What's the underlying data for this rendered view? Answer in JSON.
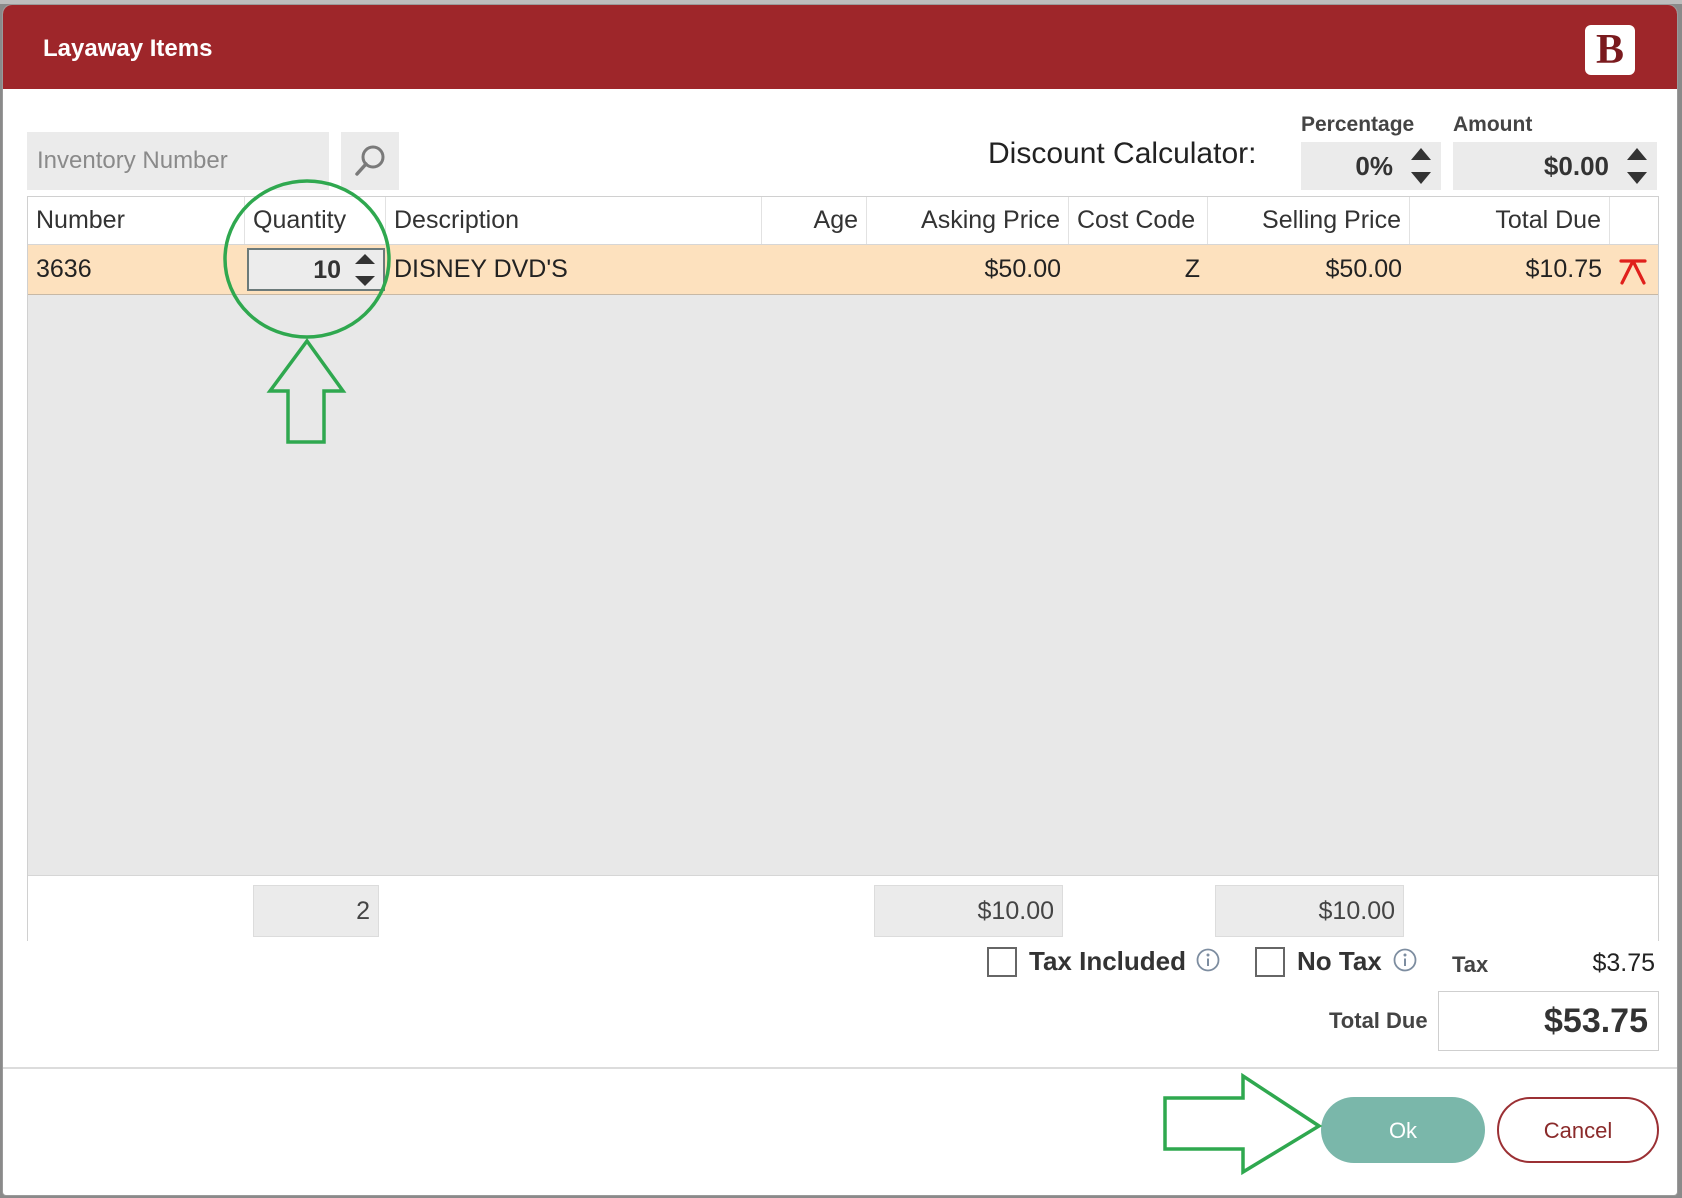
{
  "window": {
    "title": "Layaway Items",
    "logo_text": "B"
  },
  "search": {
    "placeholder": "Inventory Number",
    "icon": "search-icon"
  },
  "discount": {
    "label": "Discount Calculator:",
    "percentage_label": "Percentage",
    "percentage_value": "0%",
    "amount_label": "Amount",
    "amount_value": "$0.00"
  },
  "table": {
    "columns": [
      "Number",
      "Quantity",
      "Description",
      "Age",
      "Asking Price",
      "Cost Code",
      "Selling Price",
      "Total Due"
    ],
    "rows": [
      {
        "number": "3636",
        "quantity": "10",
        "description": "DISNEY DVD'S",
        "age": "",
        "asking_price": "$50.00",
        "cost_code": "Z",
        "selling_price": "$50.00",
        "total_due": "$10.75"
      }
    ],
    "footer": {
      "quantity": "2",
      "asking_price": "$10.00",
      "selling_price": "$10.00"
    }
  },
  "options": {
    "tax_included_label": "Tax Included",
    "no_tax_label": "No Tax"
  },
  "summary": {
    "tax_label": "Tax",
    "tax_value": "$3.75",
    "total_label": "Total Due",
    "total_value": "$53.75"
  },
  "actions": {
    "ok_label": "Ok",
    "cancel_label": "Cancel"
  },
  "colors": {
    "title_bar": "#9e262a",
    "row_highlight": "#fde1be",
    "ok_button": "#7ab7aa",
    "cancel_border": "#9b3034",
    "annotation": "#2fa84f",
    "delete_icon": "#e0201c"
  }
}
